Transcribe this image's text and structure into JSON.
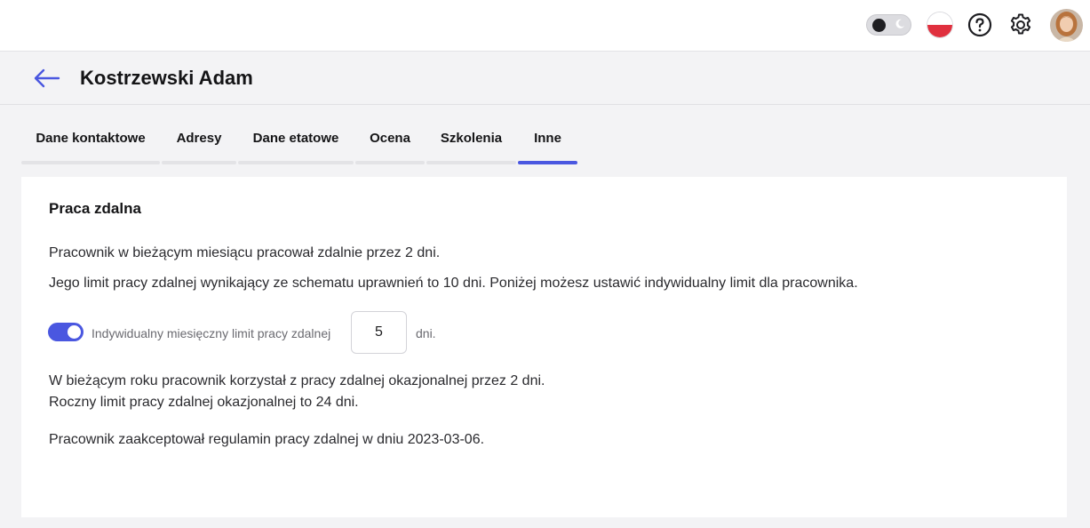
{
  "topbar": {
    "theme_toggle": {
      "state": "dark",
      "icon": "moon-icon"
    },
    "language_flag": {
      "country": "PL",
      "colors": [
        "#ffffff",
        "#e0303e"
      ]
    },
    "help_icon": "question-circle-icon",
    "settings_icon": "gear-icon",
    "avatar_icon": "user-avatar"
  },
  "header": {
    "back_icon": "arrow-left-icon",
    "title": "Kostrzewski Adam"
  },
  "tabs": [
    {
      "label": "Dane kontaktowe",
      "active": false
    },
    {
      "label": "Adresy",
      "active": false
    },
    {
      "label": "Dane etatowe",
      "active": false
    },
    {
      "label": "Ocena",
      "active": false
    },
    {
      "label": "Szkolenia",
      "active": false
    },
    {
      "label": "Inne",
      "active": true
    }
  ],
  "remote_work": {
    "heading": "Praca zdalna",
    "line1": "Pracownik w bieżącym miesiącu pracował zdalnie przez 2 dni.",
    "line2": "Jego limit pracy zdalnej wynikający ze schematu uprawnień to 10 dni. Poniżej możesz ustawić indywidualny limit dla pracownika.",
    "toggle_enabled": true,
    "toggle_label": "Indywidualny miesięczny limit pracy zdalnej",
    "limit_value": "5",
    "limit_unit": "dni.",
    "occasional_line1": "W bieżącym roku pracownik korzystał z pracy zdalnej okazjonalnej przez 2 dni.",
    "occasional_line2": "Roczny limit pracy zdalnej okazjonalnej to 24 dni.",
    "regulations_line": "Pracownik zaakceptował regulamin pracy zdalnej w dniu 2023-03-06."
  },
  "colors": {
    "accent": "#4a57e0",
    "page_bg": "#f3f3f5",
    "card_bg": "#ffffff"
  }
}
